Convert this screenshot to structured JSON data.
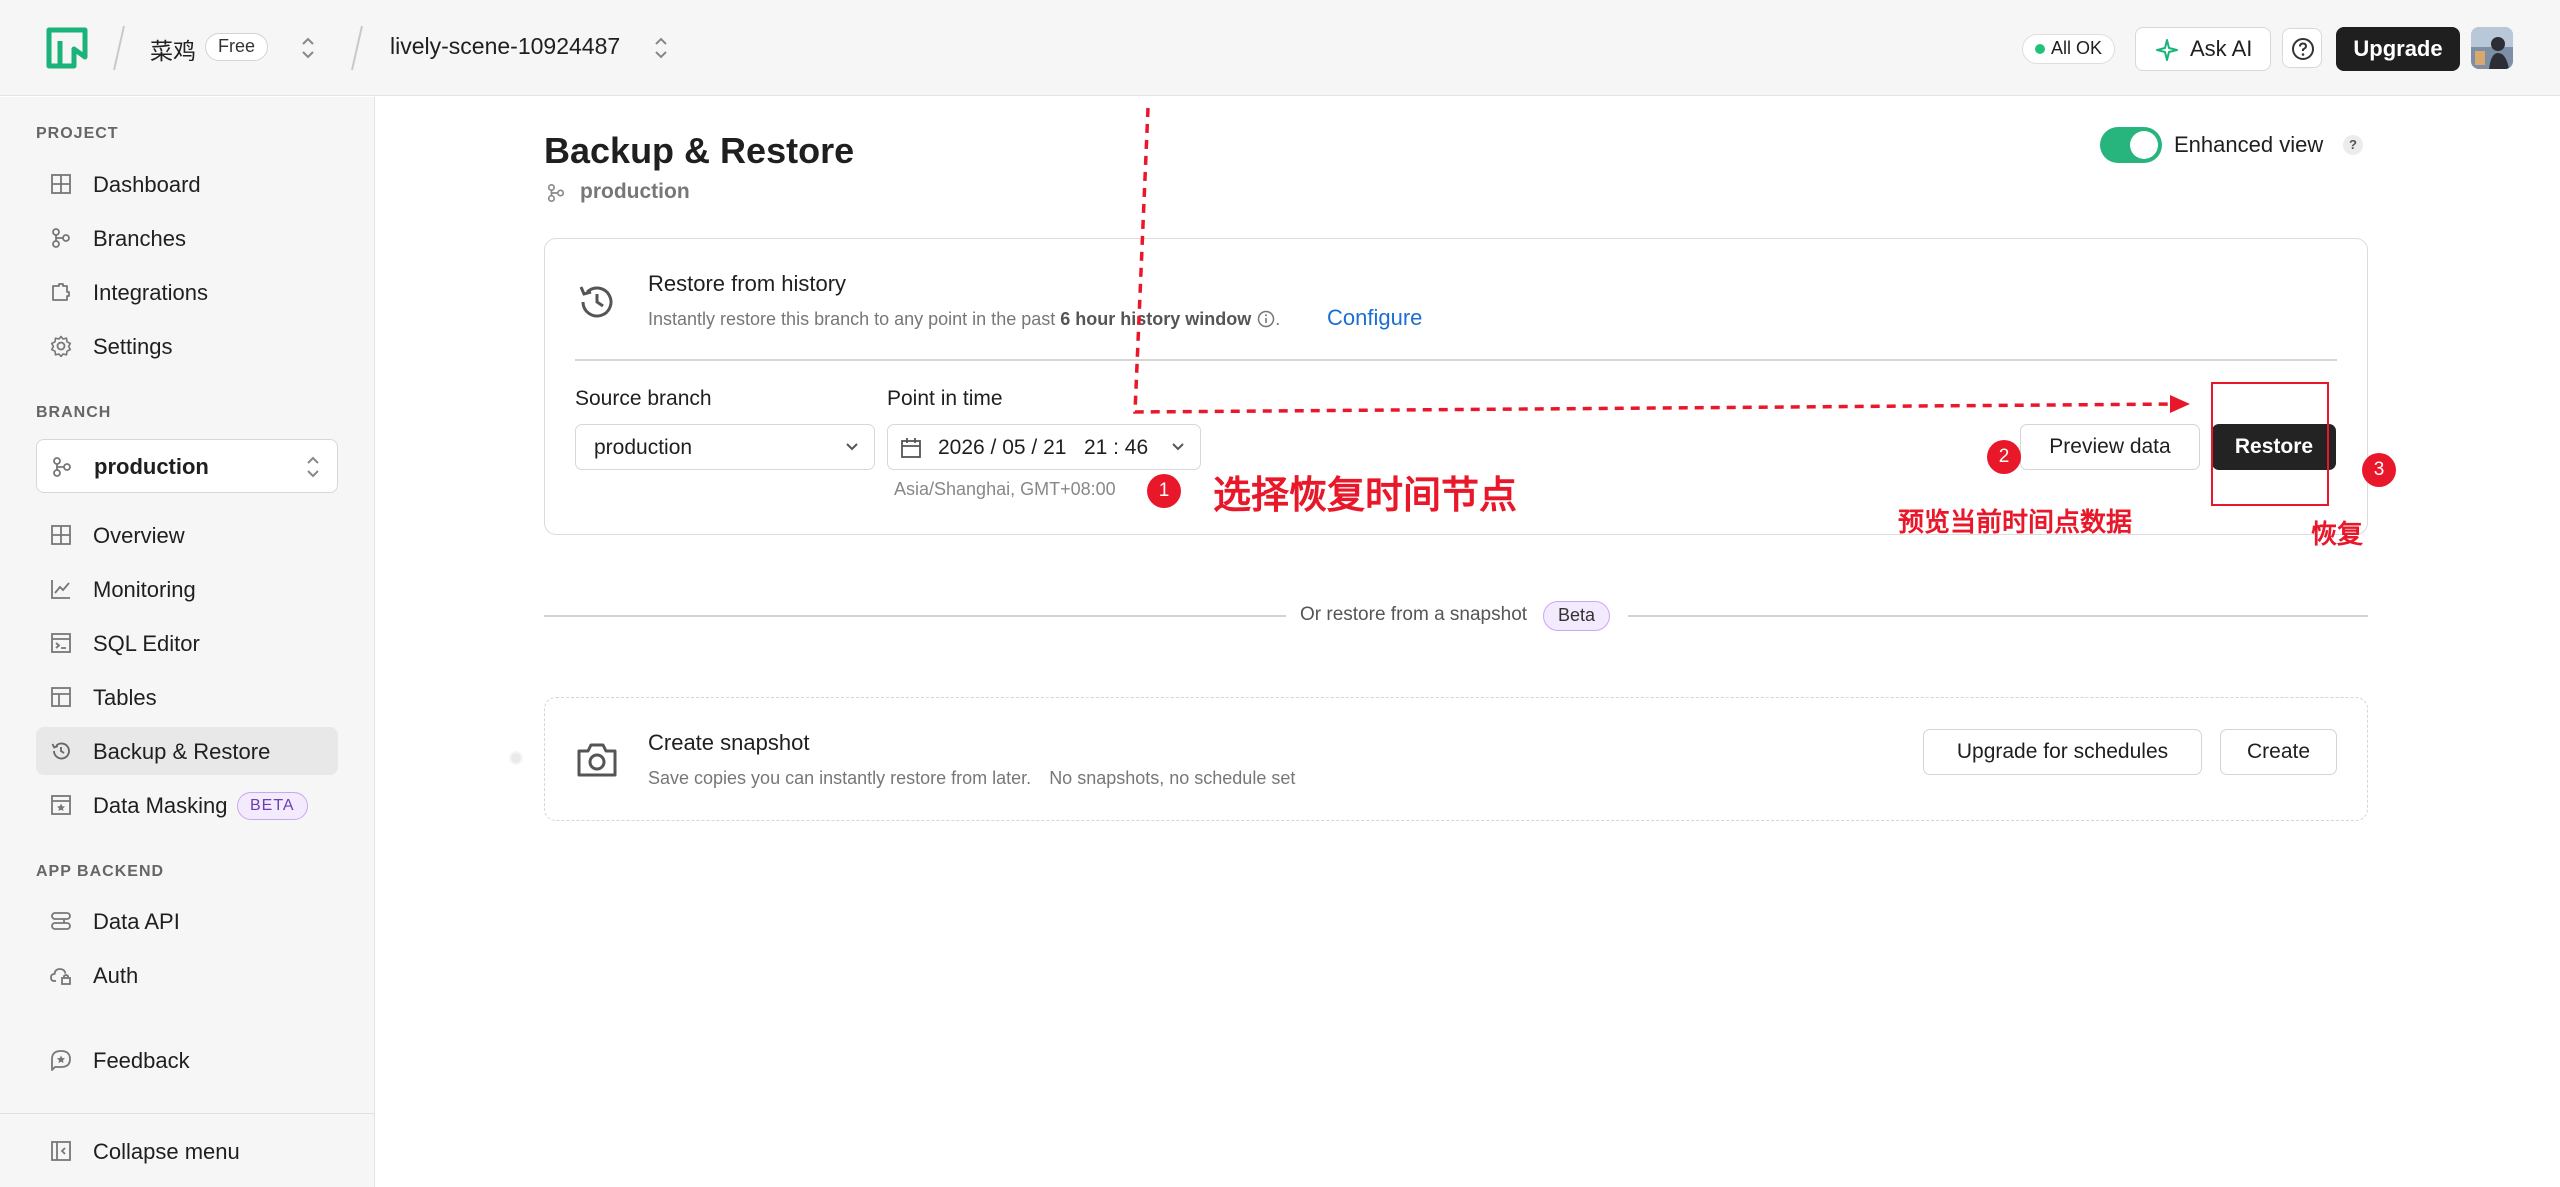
{
  "topbar": {
    "org_name": "菜鸡",
    "plan": "Free",
    "project_name": "lively-scene-10924487",
    "status": "All OK",
    "ask_ai": "Ask AI",
    "upgrade": "Upgrade"
  },
  "sidebar": {
    "project_label": "PROJECT",
    "project_items": [
      {
        "label": "Dashboard",
        "icon": "dashboard-icon"
      },
      {
        "label": "Branches",
        "icon": "branches-icon"
      },
      {
        "label": "Integrations",
        "icon": "puzzle-icon"
      },
      {
        "label": "Settings",
        "icon": "gear-icon"
      }
    ],
    "branch_label": "BRANCH",
    "branch_selected": "production",
    "branch_items": [
      {
        "label": "Overview",
        "icon": "overview-icon"
      },
      {
        "label": "Monitoring",
        "icon": "chart-icon"
      },
      {
        "label": "SQL Editor",
        "icon": "terminal-icon"
      },
      {
        "label": "Tables",
        "icon": "table-icon"
      },
      {
        "label": "Backup & Restore",
        "icon": "history-icon"
      },
      {
        "label": "Data Masking",
        "icon": "mask-icon",
        "badge": "BETA"
      }
    ],
    "backend_label": "APP BACKEND",
    "backend_items": [
      {
        "label": "Data API",
        "icon": "api-icon"
      },
      {
        "label": "Auth",
        "icon": "cloud-lock-icon"
      }
    ],
    "feedback": "Feedback",
    "collapse": "Collapse menu"
  },
  "main": {
    "title": "Backup & Restore",
    "branch": "production",
    "enhanced_view": "Enhanced view",
    "enhanced_view_help": "?",
    "enhanced_view_on": true,
    "restore": {
      "title": "Restore from history",
      "desc_prefix": "Instantly restore this branch to any point in the past ",
      "desc_bold": "6 hour history window",
      "desc_suffix": ".",
      "configure": "Configure",
      "source_label": "Source branch",
      "source_value": "production",
      "time_label": "Point in time",
      "time_value": "2026 / 05 / 21   21 : 46",
      "timezone": "Asia/Shanghai, GMT+08:00",
      "preview": "Preview data",
      "restore": "Restore"
    },
    "or_text": "Or restore from a snapshot",
    "or_badge": "Beta",
    "snapshot": {
      "title": "Create snapshot",
      "desc": "Save copies you can instantly restore from later.",
      "status": "No snapshots, no schedule set",
      "upgrade": "Upgrade for schedules",
      "create": "Create"
    }
  },
  "annotations": [
    {
      "num": "1",
      "text": "选择恢复时间节点"
    },
    {
      "num": "2",
      "text": "预览当前时间点数据"
    },
    {
      "num": "3",
      "text": "恢复"
    }
  ],
  "colors": {
    "accent_green": "#27b57d",
    "link_blue": "#1c6fd1",
    "annotation_red": "#e8182a",
    "dark_button": "#232323"
  }
}
